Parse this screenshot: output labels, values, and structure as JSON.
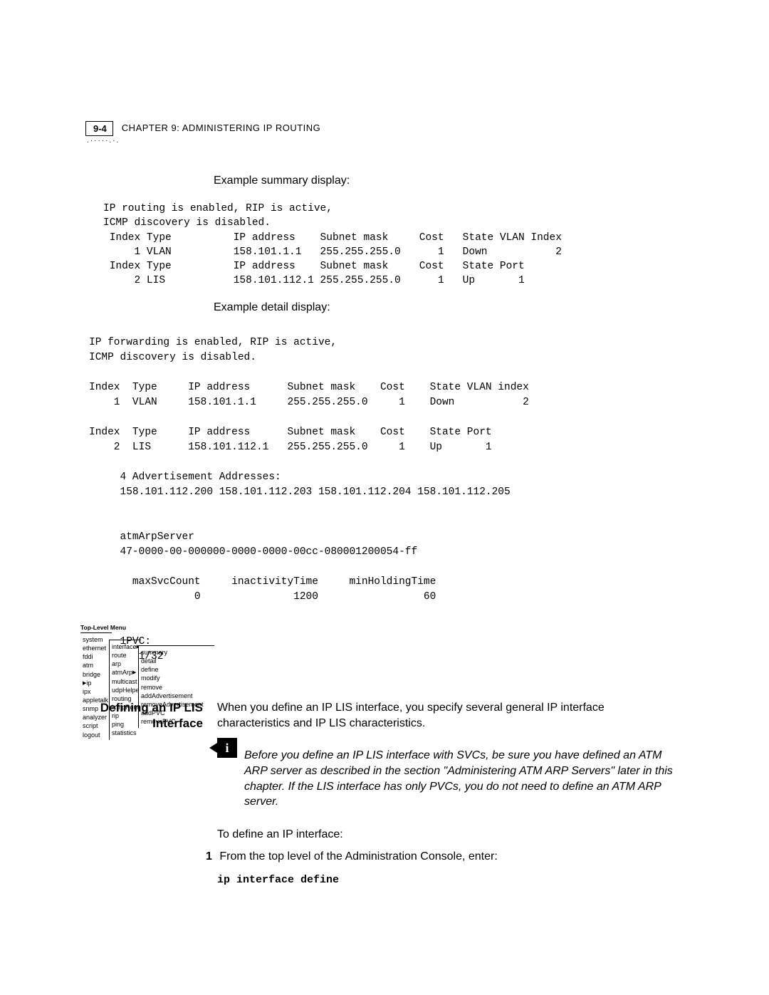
{
  "header": {
    "page_number": "9-4",
    "chapter_label": "CHAPTER 9: ADMINISTERING IP ROUTING"
  },
  "summary": {
    "caption": "Example summary display:",
    "text": "IP routing is enabled, RIP is active,\nICMP discovery is disabled.\n Index Type          IP address    Subnet mask     Cost   State VLAN Index\n     1 VLAN          158.101.1.1   255.255.255.0      1   Down           2\n Index Type          IP address    Subnet mask     Cost   State Port\n     2 LIS           158.101.112.1 255.255.255.0      1   Up       1"
  },
  "detail": {
    "caption": "Example detail display:",
    "text": "IP forwarding is enabled, RIP is active,\nICMP discovery is disabled.\n\nIndex  Type     IP address      Subnet mask    Cost    State VLAN index\n    1  VLAN     158.101.1.1     255.255.255.0     1    Down           2\n\nIndex  Type     IP address      Subnet mask    Cost    State Port\n    2  LIS      158.101.112.1   255.255.255.0     1    Up       1\n\n     4 Advertisement Addresses:\n     158.101.112.200 158.101.112.203 158.101.112.204 158.101.112.205\n\n\n     atmArpServer\n     47-0000-00-000000-0000-0000-00cc-080001200054-ff\n\n       maxSvcCount     inactivityTime     minHoldingTime\n                 0               1200                 60\n\n\n     1PVC:\n        1/32"
  },
  "section": {
    "heading": "Defining an IP LIS Interface",
    "para1": "When you define an IP LIS interface, you specify several general IP interface characteristics and IP LIS characteristics.",
    "note": "Before you define an IP LIS interface with SVCs, be sure you have defined an ATM ARP server as described in the section \"Administering ATM ARP Servers\" later in this chapter. If the LIS interface has only PVCs, you do not need to define an ATM ARP server.",
    "intro": "To define an IP interface:",
    "step1_label": "1",
    "step1_text": "From the top level of the Administration Console, enter:",
    "step1_cmd": "ip interface define"
  },
  "menu": {
    "title": "Top-Level Menu",
    "col1": [
      "system",
      "ethernet",
      "fddi",
      "atm",
      "bridge",
      "ip",
      "ipx",
      "appletalk",
      "snmp",
      "analyzer",
      "script",
      "logout"
    ],
    "col2": [
      "interface",
      "route",
      "arp",
      "atmArp",
      "multicast",
      "udpHelper",
      "routing",
      "icmpRouter",
      "rip",
      "ping",
      "statistics"
    ],
    "col3": [
      "summary",
      "detail",
      "define",
      "modify",
      "remove",
      "addAdvertisement",
      "removeAdvertisement",
      "addPVC",
      "removePVC"
    ]
  }
}
